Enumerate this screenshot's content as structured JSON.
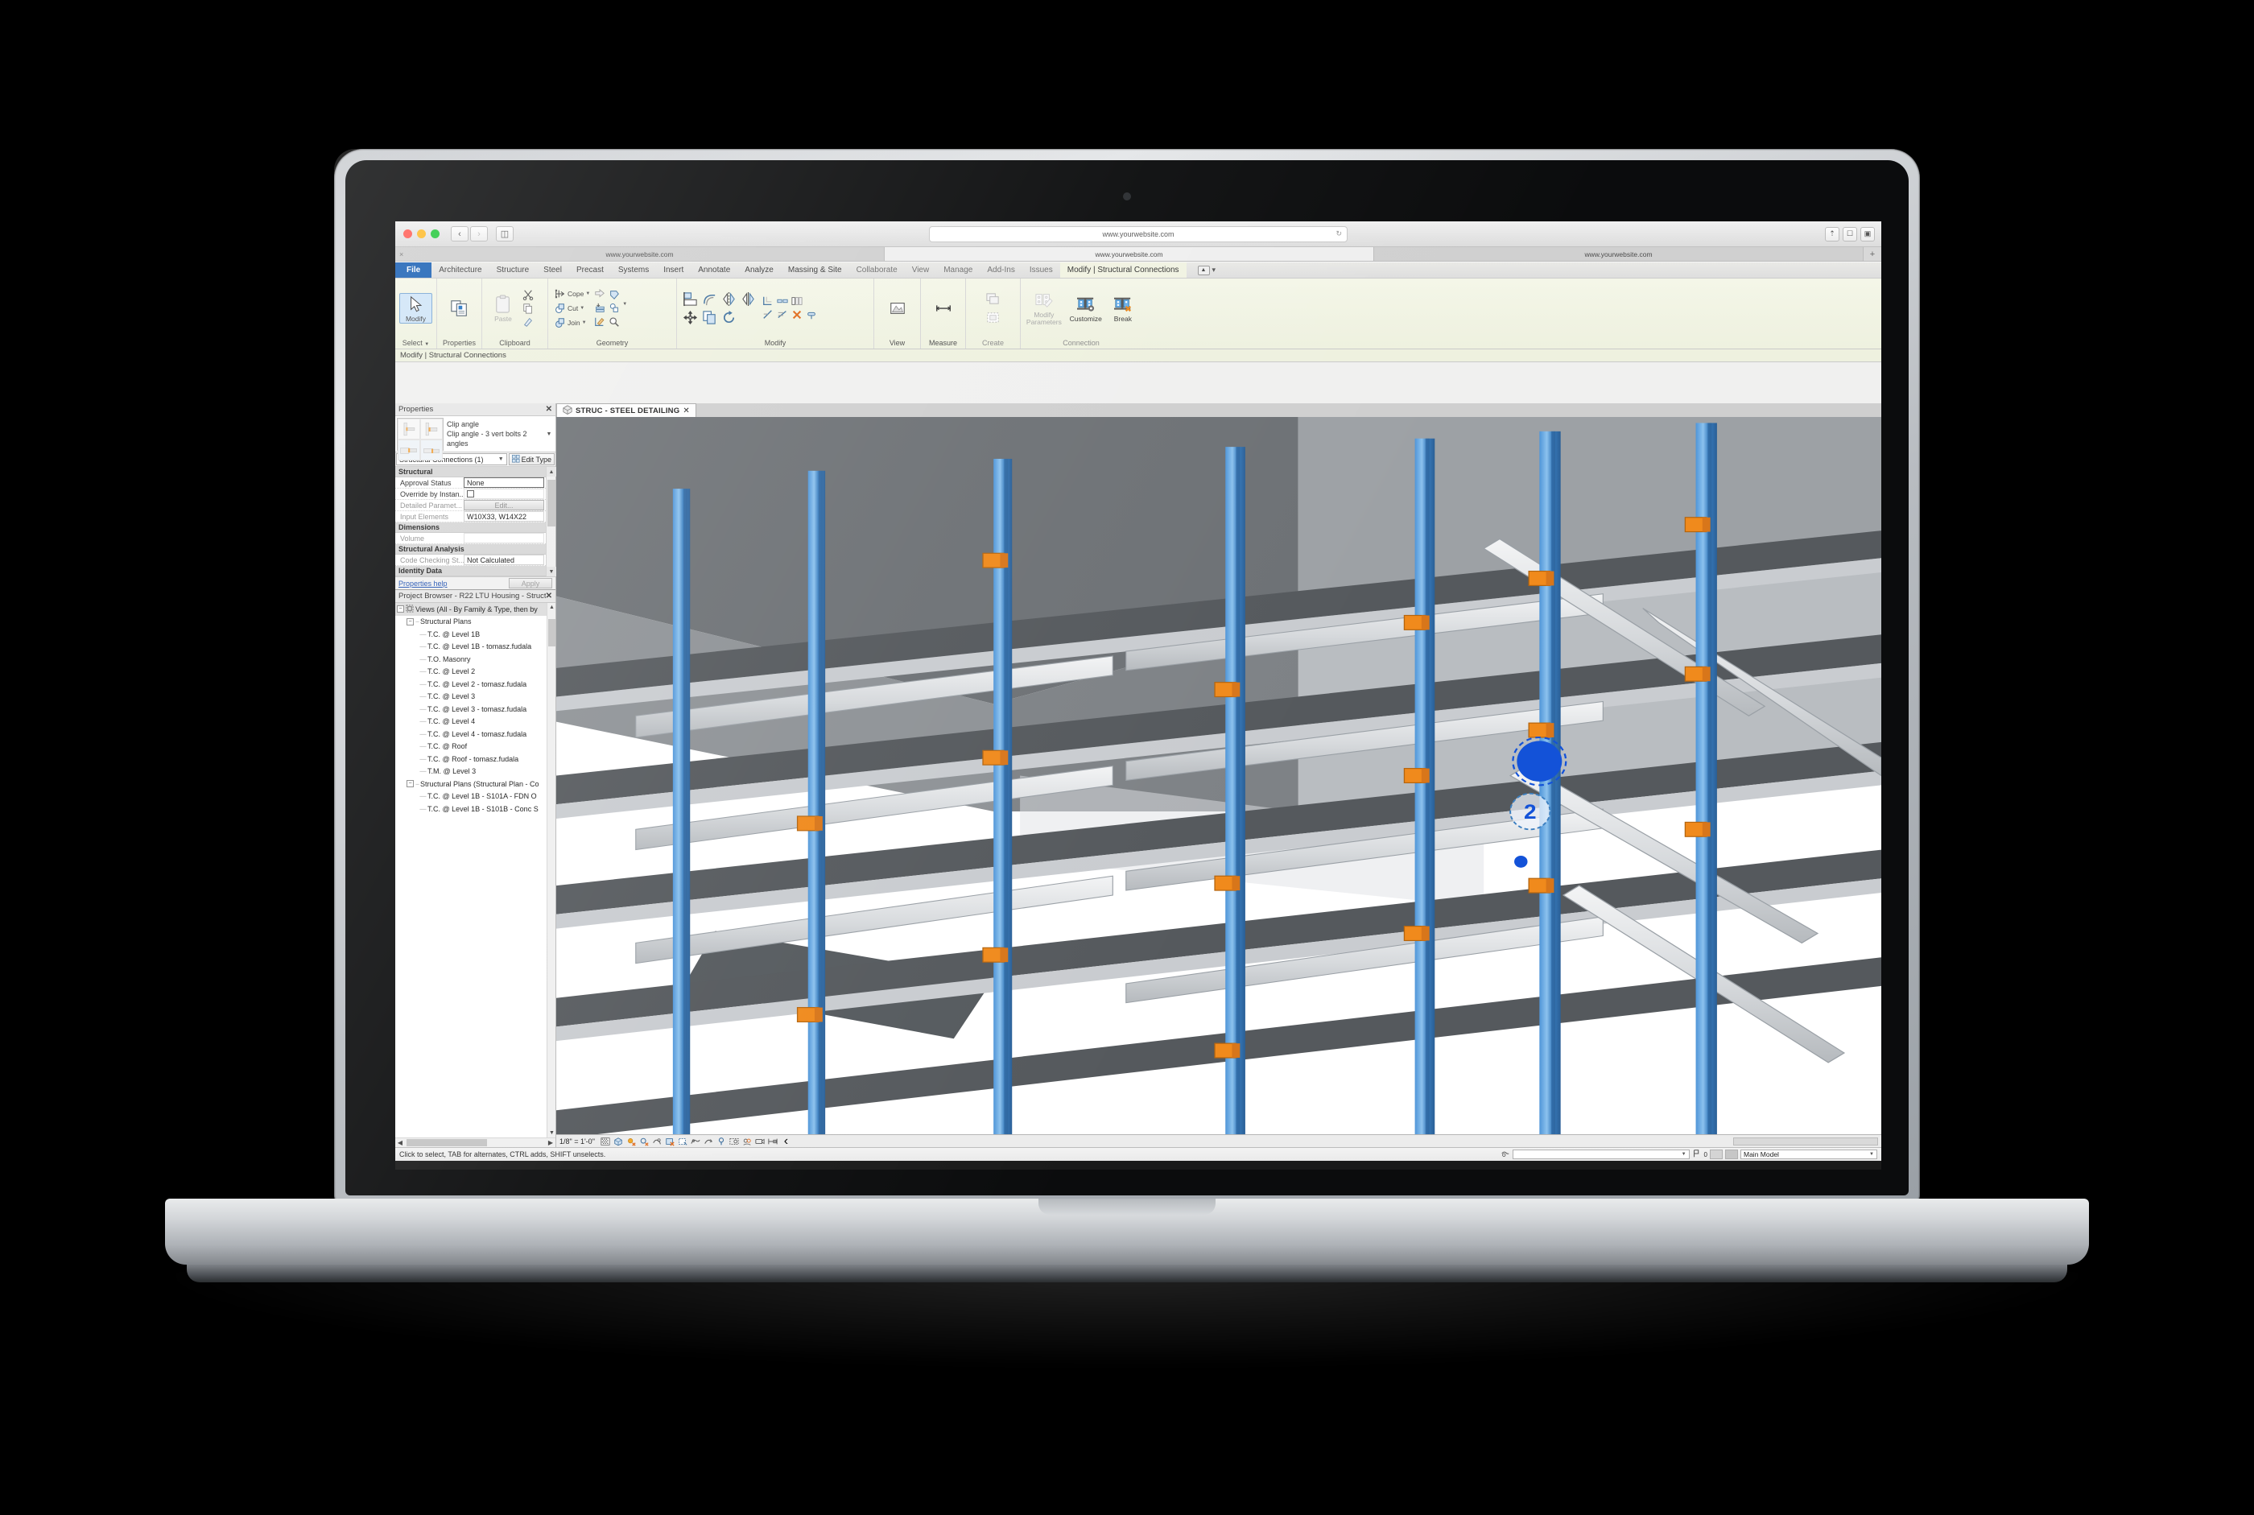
{
  "browser": {
    "url": "www.yourwebsite.com",
    "tabs": [
      {
        "label": "www.yourwebsite.com",
        "active": false
      },
      {
        "label": "www.yourwebsite.com",
        "active": true
      },
      {
        "label": "www.yourwebsite.com",
        "active": false
      }
    ],
    "back_icon": "chevron-left-icon",
    "forward_icon": "chevron-right-icon",
    "sidebar_icon": "sidebar-icon",
    "reload_icon": "reload-icon",
    "share_icon": "share-icon",
    "tabs_icon": "tabs-icon",
    "newtab_label": "+"
  },
  "app": {
    "ribbon_tabs": [
      {
        "label": "File",
        "style": "file"
      },
      {
        "label": "Architecture",
        "style": "normal"
      },
      {
        "label": "Structure",
        "style": "normal"
      },
      {
        "label": "Steel",
        "style": "normal"
      },
      {
        "label": "Precast",
        "style": "normal"
      },
      {
        "label": "Systems",
        "style": "normal"
      },
      {
        "label": "Insert",
        "style": "normal"
      },
      {
        "label": "Annotate",
        "style": "normal"
      },
      {
        "label": "Analyze",
        "style": "normal"
      },
      {
        "label": "Massing & Site",
        "style": "normal"
      },
      {
        "label": "Collaborate",
        "style": "dim"
      },
      {
        "label": "View",
        "style": "dim"
      },
      {
        "label": "Manage",
        "style": "dim"
      },
      {
        "label": "Add-Ins",
        "style": "dim"
      },
      {
        "label": "Issues",
        "style": "dim"
      },
      {
        "label": "Modify | Structural Connections",
        "style": "contextual"
      }
    ],
    "ribbon_panels": [
      {
        "label": "Select"
      },
      {
        "label": "Properties"
      },
      {
        "label": "Clipboard"
      },
      {
        "label": "Geometry"
      },
      {
        "label": "Modify"
      },
      {
        "label": "View"
      },
      {
        "label": "Measure"
      },
      {
        "label": "Create"
      },
      {
        "label": "Connection"
      }
    ],
    "ribbon_buttons": {
      "modify": "Modify",
      "paste": "Paste",
      "cope": "Cope",
      "cut": "Cut",
      "join": "Join",
      "modify_parameters_line1": "Modify",
      "modify_parameters_line2": "Parameters",
      "customize": "Customize",
      "break": "Break"
    },
    "context_bar": "Modify | Structural Connections"
  },
  "properties": {
    "title": "Properties",
    "close_icon": "close-icon",
    "family": "Clip angle",
    "type": "Clip angle - 3 vert bolts 2 angles",
    "selector_value": "Structural Connections (1)",
    "edit_type_label": "Edit Type",
    "groups": [
      {
        "name": "Structural",
        "rows": [
          {
            "name": "Approval Status",
            "value": "None",
            "kind": "boxed"
          },
          {
            "name": "Override by Instan...",
            "value": "",
            "kind": "checkbox"
          },
          {
            "name": "Detailed Paramet...",
            "value": "Edit...",
            "kind": "button",
            "dim": true
          },
          {
            "name": "Input Elements",
            "value": "W10X33, W14X22",
            "kind": "text"
          }
        ]
      },
      {
        "name": "Dimensions",
        "rows": [
          {
            "name": "Volume",
            "value": "",
            "kind": "blank"
          }
        ]
      },
      {
        "name": "Structural Analysis",
        "rows": [
          {
            "name": "Code Checking St...",
            "value": "Not Calculated",
            "kind": "text"
          }
        ]
      },
      {
        "name": "Identity Data",
        "rows": []
      }
    ],
    "help_link": "Properties help",
    "apply_label": "Apply"
  },
  "project_browser": {
    "title": "Project Browser - R22 LTU Housing - Struct...",
    "close_icon": "close-icon",
    "nodes": [
      {
        "label": "Views (All - By Family & Type, then by",
        "depth": 0,
        "expander": "minus",
        "selected": true,
        "icon": "views-icon"
      },
      {
        "label": "Structural Plans",
        "depth": 1,
        "expander": "minus"
      },
      {
        "label": "T.C. @ Level 1B",
        "depth": 2,
        "expander": "none"
      },
      {
        "label": "T.C. @ Level 1B  - tomasz.fudala",
        "depth": 2,
        "expander": "none"
      },
      {
        "label": "T.O. Masonry",
        "depth": 2,
        "expander": "none"
      },
      {
        "label": "T.C. @ Level 2",
        "depth": 2,
        "expander": "none"
      },
      {
        "label": "T.C. @ Level 2 - tomasz.fudala",
        "depth": 2,
        "expander": "none"
      },
      {
        "label": "T.C. @ Level 3",
        "depth": 2,
        "expander": "none"
      },
      {
        "label": "T.C. @ Level 3 - tomasz.fudala",
        "depth": 2,
        "expander": "none"
      },
      {
        "label": "T.C. @ Level 4",
        "depth": 2,
        "expander": "none"
      },
      {
        "label": "T.C. @ Level 4 - tomasz.fudala",
        "depth": 2,
        "expander": "none"
      },
      {
        "label": "T.C. @ Roof",
        "depth": 2,
        "expander": "none"
      },
      {
        "label": "T.C. @ Roof - tomasz.fudala",
        "depth": 2,
        "expander": "none"
      },
      {
        "label": "T.M. @ Level 3",
        "depth": 2,
        "expander": "none"
      },
      {
        "label": "Structural Plans (Structural Plan - Co",
        "depth": 1,
        "expander": "minus"
      },
      {
        "label": "T.C. @ Level 1B - S101A - FDN O",
        "depth": 2,
        "expander": "none"
      },
      {
        "label": "T.C. @ Level 1B - S101B - Conc S",
        "depth": 2,
        "expander": "none"
      }
    ]
  },
  "view": {
    "tab_label": "STRUC - STEEL DETAILING",
    "tab_icon": "home-3d-icon",
    "tab_close_icon": "close-icon",
    "scale": "1/8\" = 1'-0\"",
    "control_icons": [
      "detail-level-icon",
      "visual-style-icon",
      "sun-path-icon",
      "shadows-icon",
      "rendering-dialog-icon",
      "crop-region-icon",
      "crop-region-hide-icon",
      "analytical-model-icon",
      "temporary-hide-icon",
      "reveal-hidden-icon",
      "temporary-view-icon",
      "worksharing-display-icon",
      "constraints-icon"
    ],
    "collapse_icon": "chevron-left-icon",
    "selection_marker": "selected-connection-node"
  },
  "status_bar": {
    "message": "Click to select, TAB for alternates, CTRL adds, SHIFT unselects.",
    "filter_icon": "filter-icon",
    "filter_value": "",
    "design_option_icon": "design-options-icon",
    "design_option_count": "0",
    "model_label": "Main Model",
    "worksets_icon": "worksets-icon",
    "exclude_icon": "exclude-options-icon"
  },
  "colors": {
    "accent_blue": "#1b61b5",
    "contextual_tab": "#f1f3e2",
    "steel_blue": "#2f7fd0",
    "connection_orange": "#f08a1c",
    "selection_blue": "#1352d8",
    "beam_gray": "#c9ccd0"
  }
}
